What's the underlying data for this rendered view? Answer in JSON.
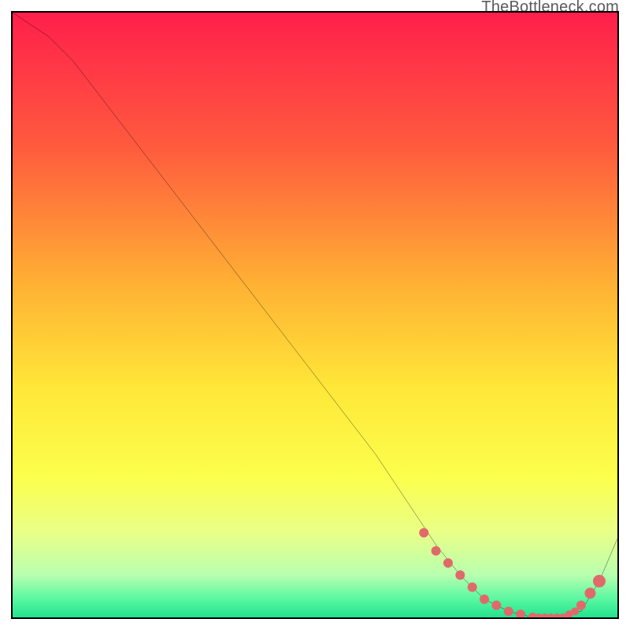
{
  "watermark": "TheBottleneck.com",
  "chart_data": {
    "type": "line",
    "title": "",
    "xlabel": "",
    "ylabel": "",
    "xlim": [
      0,
      100
    ],
    "ylim": [
      0,
      100
    ],
    "grid": false,
    "legend": false,
    "gradient_stops": [
      {
        "offset": 0,
        "color": "#ff1f4b"
      },
      {
        "offset": 0.22,
        "color": "#ff5a3e"
      },
      {
        "offset": 0.45,
        "color": "#ffb134"
      },
      {
        "offset": 0.62,
        "color": "#ffe738"
      },
      {
        "offset": 0.77,
        "color": "#fbff4d"
      },
      {
        "offset": 0.86,
        "color": "#e9ff88"
      },
      {
        "offset": 0.93,
        "color": "#b8ffaf"
      },
      {
        "offset": 0.97,
        "color": "#58f7a1"
      },
      {
        "offset": 1.0,
        "color": "#23e38e"
      }
    ],
    "series": [
      {
        "name": "bottleneck-curve",
        "color": "#000000",
        "x": [
          0,
          6,
          10,
          20,
          30,
          40,
          50,
          60,
          66,
          70,
          74,
          78,
          82,
          86,
          90,
          94,
          97,
          100
        ],
        "y": [
          100,
          96,
          92,
          79,
          66,
          53,
          40,
          27,
          18,
          12,
          7,
          3,
          1,
          0,
          0,
          1,
          6,
          13
        ]
      }
    ],
    "markers": {
      "name": "highlight-dots",
      "color": "#e06a6a",
      "radius_seq": [
        6,
        6,
        6,
        6,
        6,
        6,
        6,
        6,
        6,
        6,
        5,
        5,
        5,
        5,
        5,
        5,
        5,
        6,
        7,
        8
      ],
      "x": [
        68,
        70,
        72,
        74,
        76,
        78,
        80,
        82,
        84,
        86,
        87,
        88,
        89,
        90,
        91,
        92,
        93,
        94,
        95.5,
        97
      ],
      "y": [
        14,
        11,
        9,
        7,
        5,
        3,
        2,
        1,
        0.5,
        0,
        0,
        0,
        0,
        0,
        0,
        0.5,
        1,
        2,
        4,
        6
      ]
    }
  }
}
